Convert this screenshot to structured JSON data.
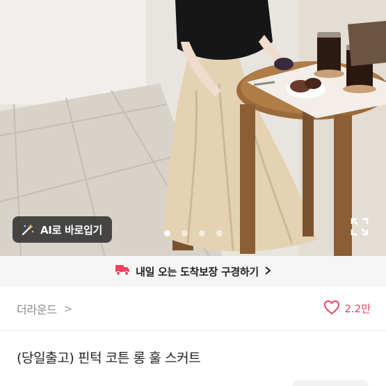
{
  "gallery": {
    "ai_button_label": "AI로 바로입기",
    "total_images": 4,
    "active_index": 0
  },
  "delivery_banner": {
    "text": "내일 오는 도착보장 구경하기",
    "icon": "truck-icon",
    "accent_color": "#f0435c"
  },
  "shop": {
    "name": "더라운드",
    "chevron": ">",
    "like_icon": "heart-outline-icon",
    "like_count": "2.2만",
    "like_color": "#e8415a"
  },
  "product": {
    "title": "(당일출고) 핀턱 코튼 롱 훌 스커트"
  }
}
